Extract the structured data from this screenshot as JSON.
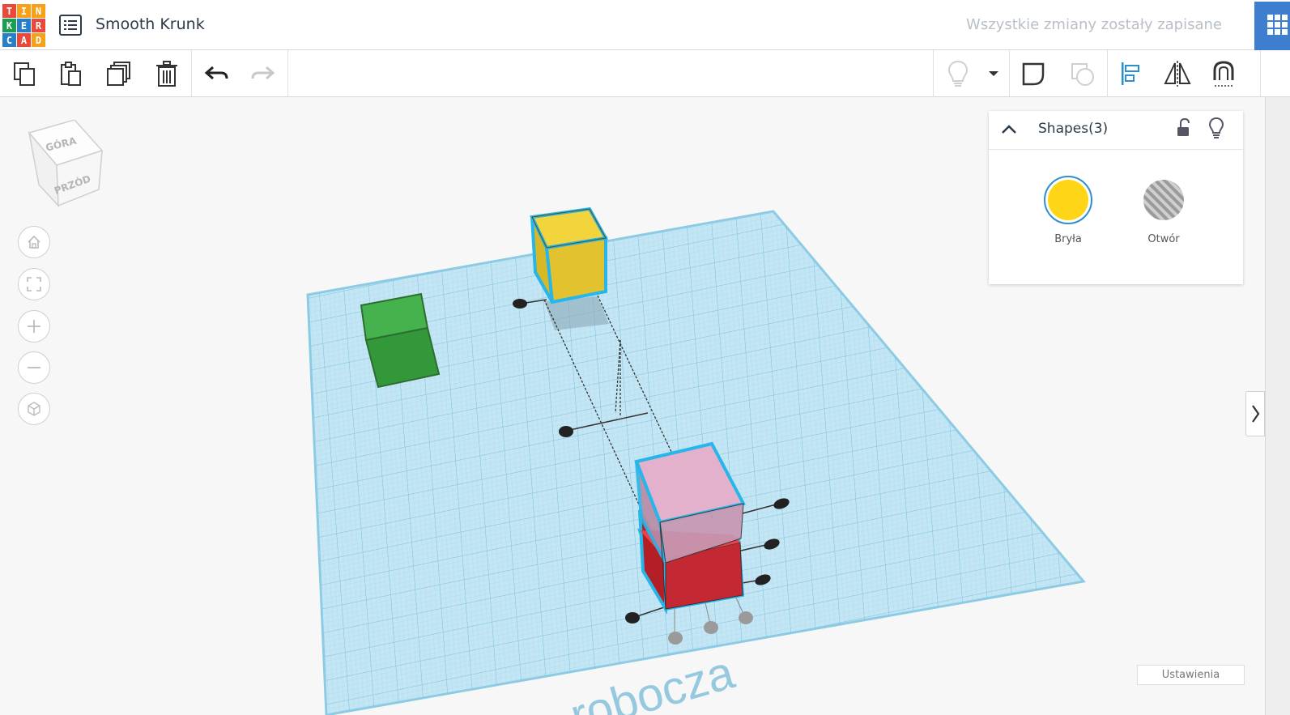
{
  "header": {
    "logo_letters": [
      "T",
      "I",
      "N",
      "K",
      "E",
      "R",
      "C",
      "A",
      "D"
    ],
    "logo_colors": [
      "#e8493b",
      "#f7a11a",
      "#f7a11a",
      "#1d9d51",
      "#2680c8",
      "#e8493b",
      "#2680c8",
      "#e8493b",
      "#f7a11a"
    ],
    "project_title": "Smooth Krunk",
    "save_status": "Wszystkie zmiany zostały zapisane"
  },
  "toolbar": {
    "left_icons": [
      "copy-icon",
      "paste-icon",
      "duplicate-icon",
      "delete-icon",
      "undo-icon",
      "redo-icon"
    ],
    "right_icons": [
      "light-bulb-icon",
      "dropdown-arrow-icon",
      "group-icon",
      "ungroup-icon",
      "align-icon",
      "mirror-icon",
      "magnet-icon"
    ]
  },
  "viewcube": {
    "top_label": "GÓRA",
    "front_label": "PRZÓD"
  },
  "nav_icons": [
    "home-icon",
    "fit-view-icon",
    "zoom-in-icon",
    "zoom-out-icon",
    "perspective-icon"
  ],
  "shapes_panel": {
    "title": "Shapes(3)",
    "solid_label": "Bryła",
    "hole_label": "Otwór",
    "solid_color": "#ffd617"
  },
  "workplane": {
    "watermark": "robocza"
  },
  "settings_label": "Ustawienia",
  "colors": {
    "workplane": "#bfe3f2",
    "grid": "#8fcde6",
    "green_box": "#3aa542",
    "yellow_box": "#f0d239",
    "pink_box": "#e4b2cc",
    "red_box": "#d8303e",
    "selection": "#27b6e9"
  }
}
